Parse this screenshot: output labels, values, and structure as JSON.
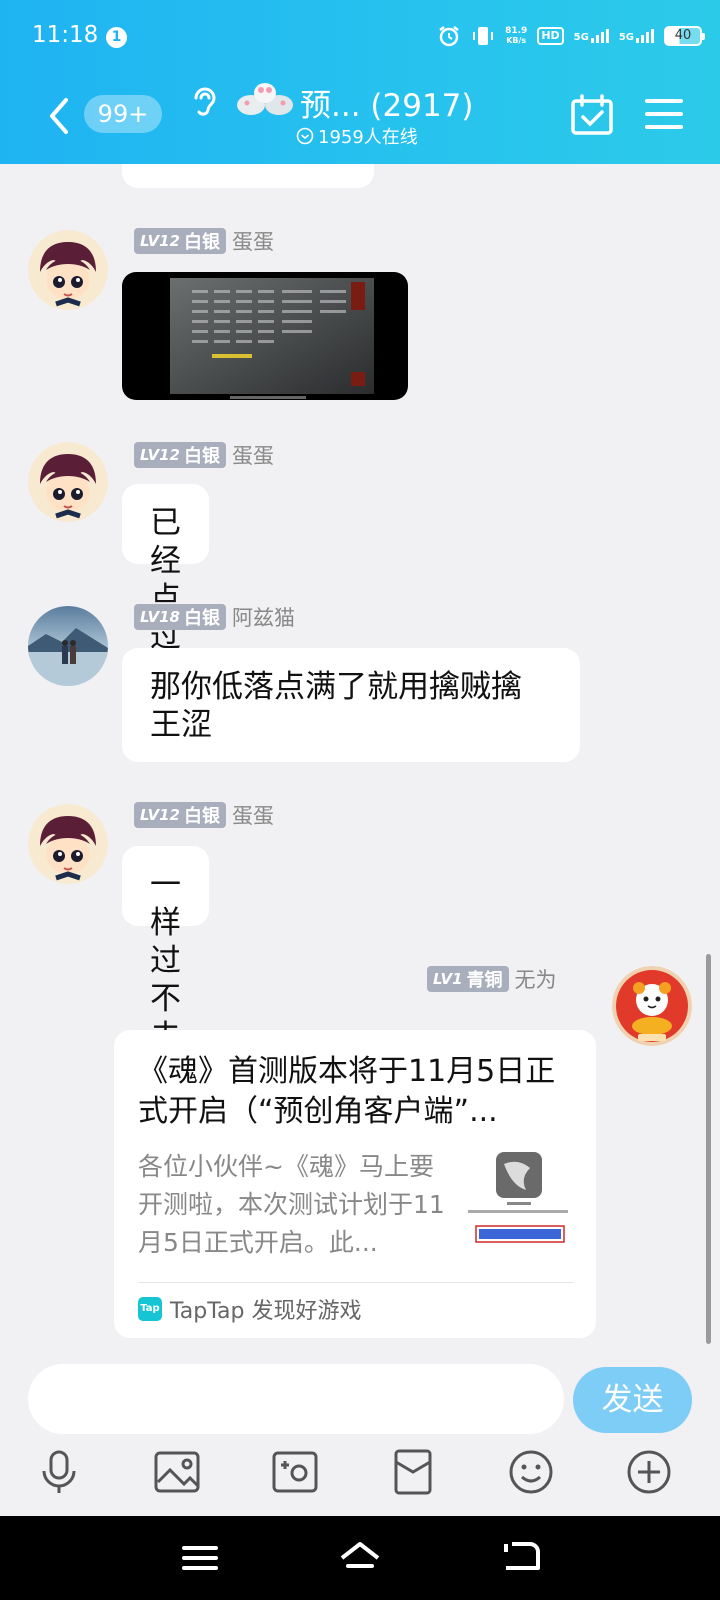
{
  "status_bar": {
    "time": "11:18",
    "net_speed_value": "81.9",
    "net_speed_unit": "KB/s",
    "hd_label": "HD",
    "sim1_label": "5G",
    "sim2_label": "5G",
    "battery": "40"
  },
  "header": {
    "unread_badge": "99+",
    "group_title": "预... (2917)",
    "online_count": "1959人在线"
  },
  "messages": [
    {
      "level": "LV12",
      "rank": "白银",
      "nick": "蛋蛋",
      "type": "image"
    },
    {
      "level": "LV12",
      "rank": "白银",
      "nick": "蛋蛋",
      "text": "已经点过了"
    },
    {
      "level": "LV18",
      "rank": "白银",
      "nick": "阿兹猫",
      "text": "那你低落点满了就用擒贼擒王涩"
    },
    {
      "level": "LV12",
      "rank": "白银",
      "nick": "蛋蛋",
      "text": "一样过不去"
    },
    {
      "level": "LV1",
      "rank": "青铜",
      "nick": "无为",
      "type": "link"
    }
  ],
  "link_card": {
    "title": "《魂》首测版本将于11月5日正式开启（“预创角客户端”...",
    "description": "各位小伙伴~《魂》马上要开测啦，本次测试计划于11月5日正式开启。此...",
    "source_icon": "Tap",
    "source": "TapTap 发现好游戏"
  },
  "input": {
    "placeholder": "",
    "send_label": "发送"
  },
  "toolbar_icons": [
    "microphone-icon",
    "image-icon",
    "camera-icon",
    "red-packet-icon",
    "emoji-icon",
    "plus-icon"
  ],
  "colors": {
    "header_start": "#1fb3f2",
    "header_end": "#2ccae9",
    "send_button": "#7ecdf7",
    "level_badge": "#a9aebd",
    "background": "#f1f1f3"
  }
}
